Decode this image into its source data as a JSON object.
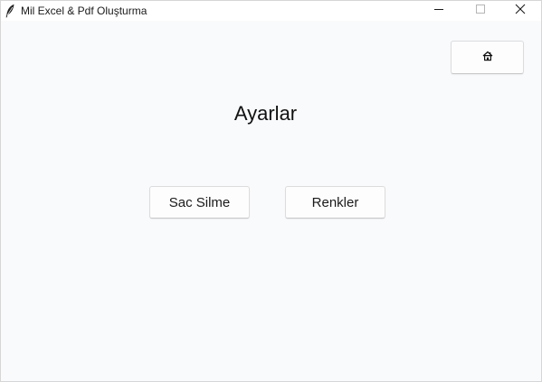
{
  "window": {
    "title": "Mil Excel & Pdf Oluşturma",
    "app_icon": "feather-icon",
    "controls": {
      "minimize": "minimize-icon",
      "maximize": "maximize-icon",
      "close": "close-icon"
    }
  },
  "header": {
    "home_icon": "home-icon"
  },
  "main": {
    "title": "Ayarlar",
    "buttons": {
      "sac_silme": "Sac Silme",
      "renkler": "Renkler"
    }
  },
  "colors": {
    "background": "#f9fafc",
    "titlebar": "#ffffff",
    "button": "#fdfdfd"
  }
}
